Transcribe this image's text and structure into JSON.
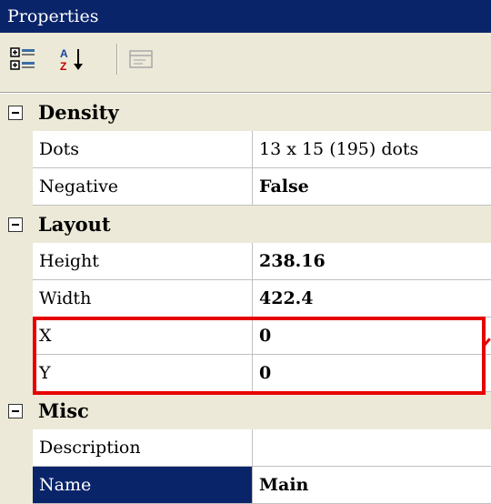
{
  "window": {
    "title": "Properties"
  },
  "toolbar": {
    "buttons": [
      {
        "icon": "categorized-icon",
        "enabled": true
      },
      {
        "icon": "alphabetical-sort-icon",
        "enabled": true
      },
      {
        "icon": "property-pages-icon",
        "enabled": false
      }
    ]
  },
  "grid": {
    "categories": [
      {
        "label": "Density",
        "expanded": true,
        "properties": [
          {
            "name": "Dots",
            "value": "13 x 15 (195) dots",
            "bold": false
          },
          {
            "name": "Negative",
            "value": "False",
            "bold": true
          }
        ]
      },
      {
        "label": "Layout",
        "expanded": true,
        "properties": [
          {
            "name": "Height",
            "value": "238.16",
            "bold": true
          },
          {
            "name": "Width",
            "value": "422.4",
            "bold": true
          },
          {
            "name": "X",
            "value": "0",
            "bold": true
          },
          {
            "name": "Y",
            "value": "0",
            "bold": true
          }
        ]
      },
      {
        "label": "Misc",
        "expanded": true,
        "properties": [
          {
            "name": "Description",
            "value": "",
            "bold": false
          },
          {
            "name": "Name",
            "value": "Main",
            "bold": true,
            "selected": true
          }
        ]
      }
    ]
  },
  "colors": {
    "title_bar": "#0a246a",
    "highlight": "#e60000",
    "gutter": "#ece9d8"
  }
}
